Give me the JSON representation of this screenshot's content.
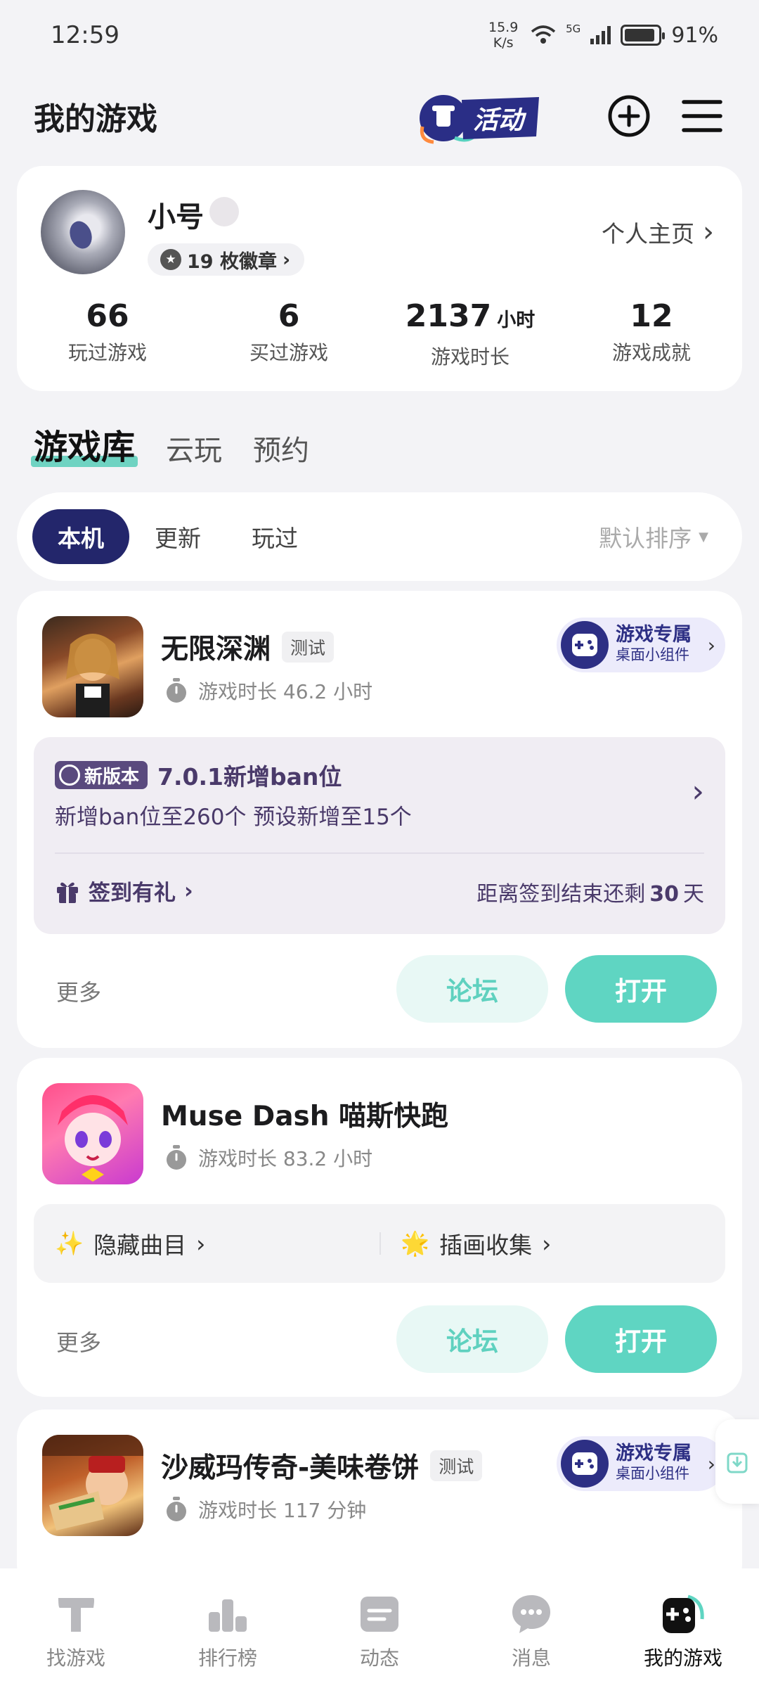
{
  "status": {
    "time": "12:59",
    "speed_value": "15.9",
    "speed_unit": "K/s",
    "network": "5G",
    "battery": "91%",
    "battery_level": 0.91
  },
  "header": {
    "title": "我的游戏",
    "activity_label": "活动"
  },
  "profile": {
    "name": "小号",
    "badges": "19 枚徽章",
    "homepage": "个人主页",
    "stats": [
      {
        "value": "66",
        "unit": "",
        "label": "玩过游戏"
      },
      {
        "value": "6",
        "unit": "",
        "label": "买过游戏"
      },
      {
        "value": "2137",
        "unit": "小时",
        "label": "游戏时长"
      },
      {
        "value": "12",
        "unit": "",
        "label": "游戏成就"
      }
    ]
  },
  "tabs": [
    "游戏库",
    "云玩",
    "预约"
  ],
  "filters": {
    "chips": [
      "本机",
      "更新",
      "玩过"
    ],
    "sort": "默认排序"
  },
  "games": [
    {
      "name": "无限深渊",
      "tag": "测试",
      "playtime": "游戏时长 46.2 小时",
      "widget": {
        "title": "游戏专属",
        "subtitle": "桌面小组件"
      },
      "news": {
        "tag": "新版本",
        "title": "7.0.1新增ban位",
        "desc": "新增ban位至260个 预设新增至15个",
        "checkin": "签到有礼",
        "remain_prefix": "距离签到结束还剩",
        "remain_days": "30",
        "remain_suffix": "天"
      },
      "more": "更多",
      "forum": "论坛",
      "open": "打开"
    },
    {
      "name": "Muse Dash 喵斯快跑",
      "playtime": "游戏时长 83.2 小时",
      "features": [
        {
          "emoji": "✨",
          "label": "隐藏曲目"
        },
        {
          "emoji": "🌟",
          "label": "插画收集"
        }
      ],
      "more": "更多",
      "forum": "论坛",
      "open": "打开"
    },
    {
      "name": "沙威玛传奇-美味卷饼",
      "tag": "测试",
      "playtime": "游戏时长 117 分钟",
      "widget": {
        "title": "游戏专属",
        "subtitle": "桌面小组件"
      }
    }
  ],
  "bottom_nav": [
    "找游戏",
    "排行榜",
    "动态",
    "消息",
    "我的游戏"
  ]
}
